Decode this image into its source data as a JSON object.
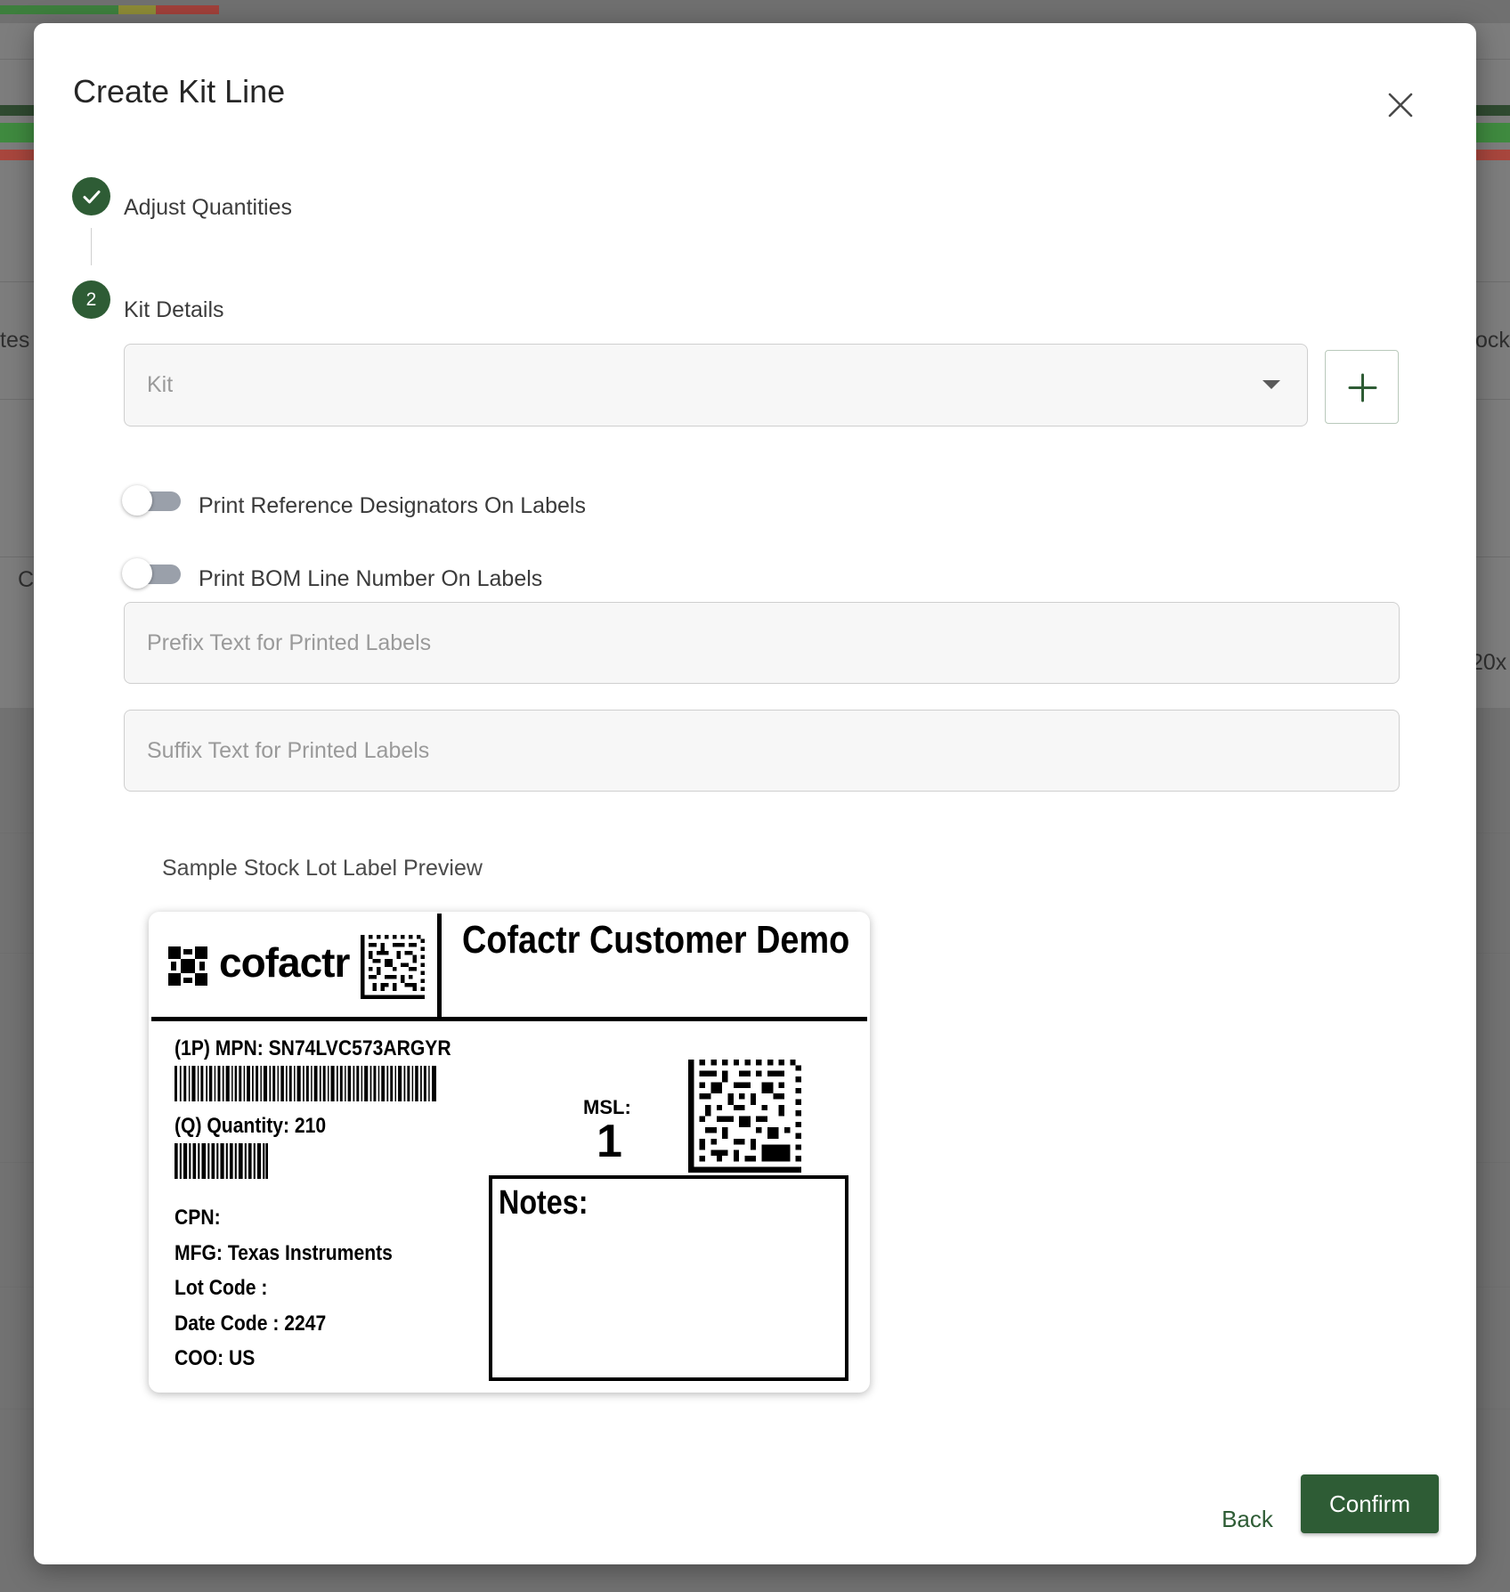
{
  "background": {
    "fragments": [
      "tes",
      "C",
      "tock",
      "20x"
    ]
  },
  "modal": {
    "title": "Create Kit Line",
    "close_icon": "close-icon"
  },
  "stepper": {
    "steps": [
      {
        "label": "Adjust Quantities",
        "status": "completed",
        "icon": "check-icon"
      },
      {
        "label": "Kit Details",
        "status": "active",
        "number": "2"
      }
    ]
  },
  "form": {
    "kit_select": {
      "placeholder": "Kit",
      "value": ""
    },
    "add_kit_icon": "plus-icon",
    "toggles": [
      {
        "label": "Print Reference Designators On Labels",
        "checked": false
      },
      {
        "label": "Print BOM Line Number On Labels",
        "checked": false
      }
    ],
    "prefix": {
      "placeholder": "Prefix Text for Printed Labels",
      "value": ""
    },
    "suffix": {
      "placeholder": "Suffix Text for Printed Labels",
      "value": ""
    }
  },
  "preview": {
    "caption": "Sample Stock Lot Label Preview",
    "label": {
      "logo_text": "cofactr",
      "customer": "Cofactr Customer Demo",
      "mpn": "(1P) MPN: SN74LVC573ARGYR",
      "quantity": "(Q) Quantity: 210",
      "cpn": "CPN:",
      "mfg": "MFG: Texas Instruments",
      "lot_code": "Lot Code :",
      "date_code": "Date Code : 2247",
      "coo": "COO: US",
      "msl_label": "MSL:",
      "msl_value": "1",
      "notes_label": "Notes:"
    }
  },
  "footer": {
    "back_label": "Back",
    "confirm_label": "Confirm"
  },
  "colors": {
    "primary": "#2e5c35",
    "overlay": "#7d7d7d",
    "toggle_off_track": "#9aa0aa"
  }
}
